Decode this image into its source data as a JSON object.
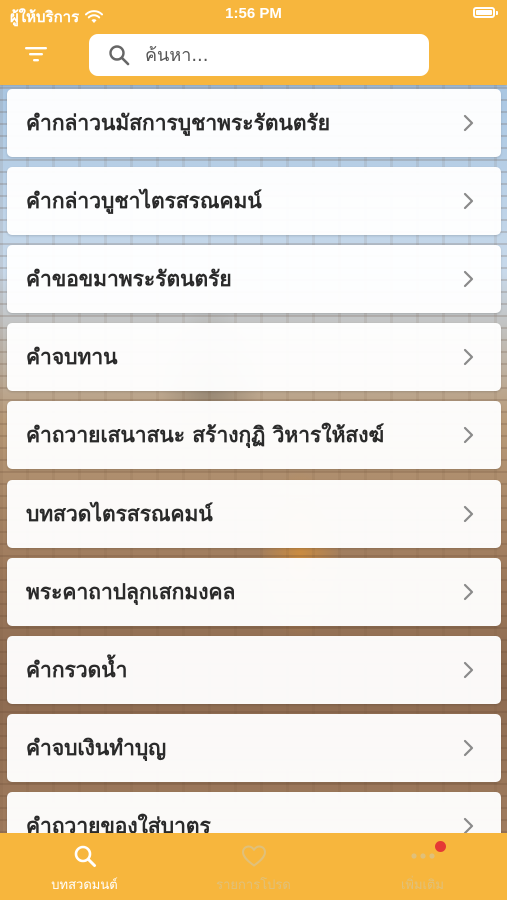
{
  "status_bar": {
    "carrier": "ผู้ให้บริการ",
    "time": "1:56 PM"
  },
  "header": {
    "menu_icon": "filter-icon",
    "search": {
      "placeholder": "ค้นหา...",
      "value": ""
    }
  },
  "list": {
    "items": [
      {
        "label": "คำกล่าวนมัสการบูชาพระรัตนตรัย"
      },
      {
        "label": "คำกล่าวบูชาไตรสรณคมน์"
      },
      {
        "label": "คำขอขมาพระรัตนตรัย"
      },
      {
        "label": "คำจบทาน"
      },
      {
        "label": "คำถวายเสนาสนะ สร้างกุฏิ วิหารให้สงฆ์"
      },
      {
        "label": "บทสวดไตรสรณคมน์"
      },
      {
        "label": "พระคาถาปลุกเสกมงคล"
      },
      {
        "label": "คำกรวดน้ำ"
      },
      {
        "label": "คำจบเงินทำบุญ"
      },
      {
        "label": "คำถวายของใส่บาตร"
      }
    ]
  },
  "tabbar": {
    "tabs": [
      {
        "label": "บทสวดมนต์",
        "icon": "search-icon",
        "active": true
      },
      {
        "label": "รายการโปรด",
        "icon": "heart-icon",
        "active": false
      },
      {
        "label": "เพิ่มเติม",
        "icon": "more-icon",
        "active": false
      }
    ]
  },
  "colors": {
    "accent": "#f7b63d",
    "badge": "#e53935",
    "tab_active": "#ffffff",
    "tab_inactive": "#e0c07a"
  }
}
